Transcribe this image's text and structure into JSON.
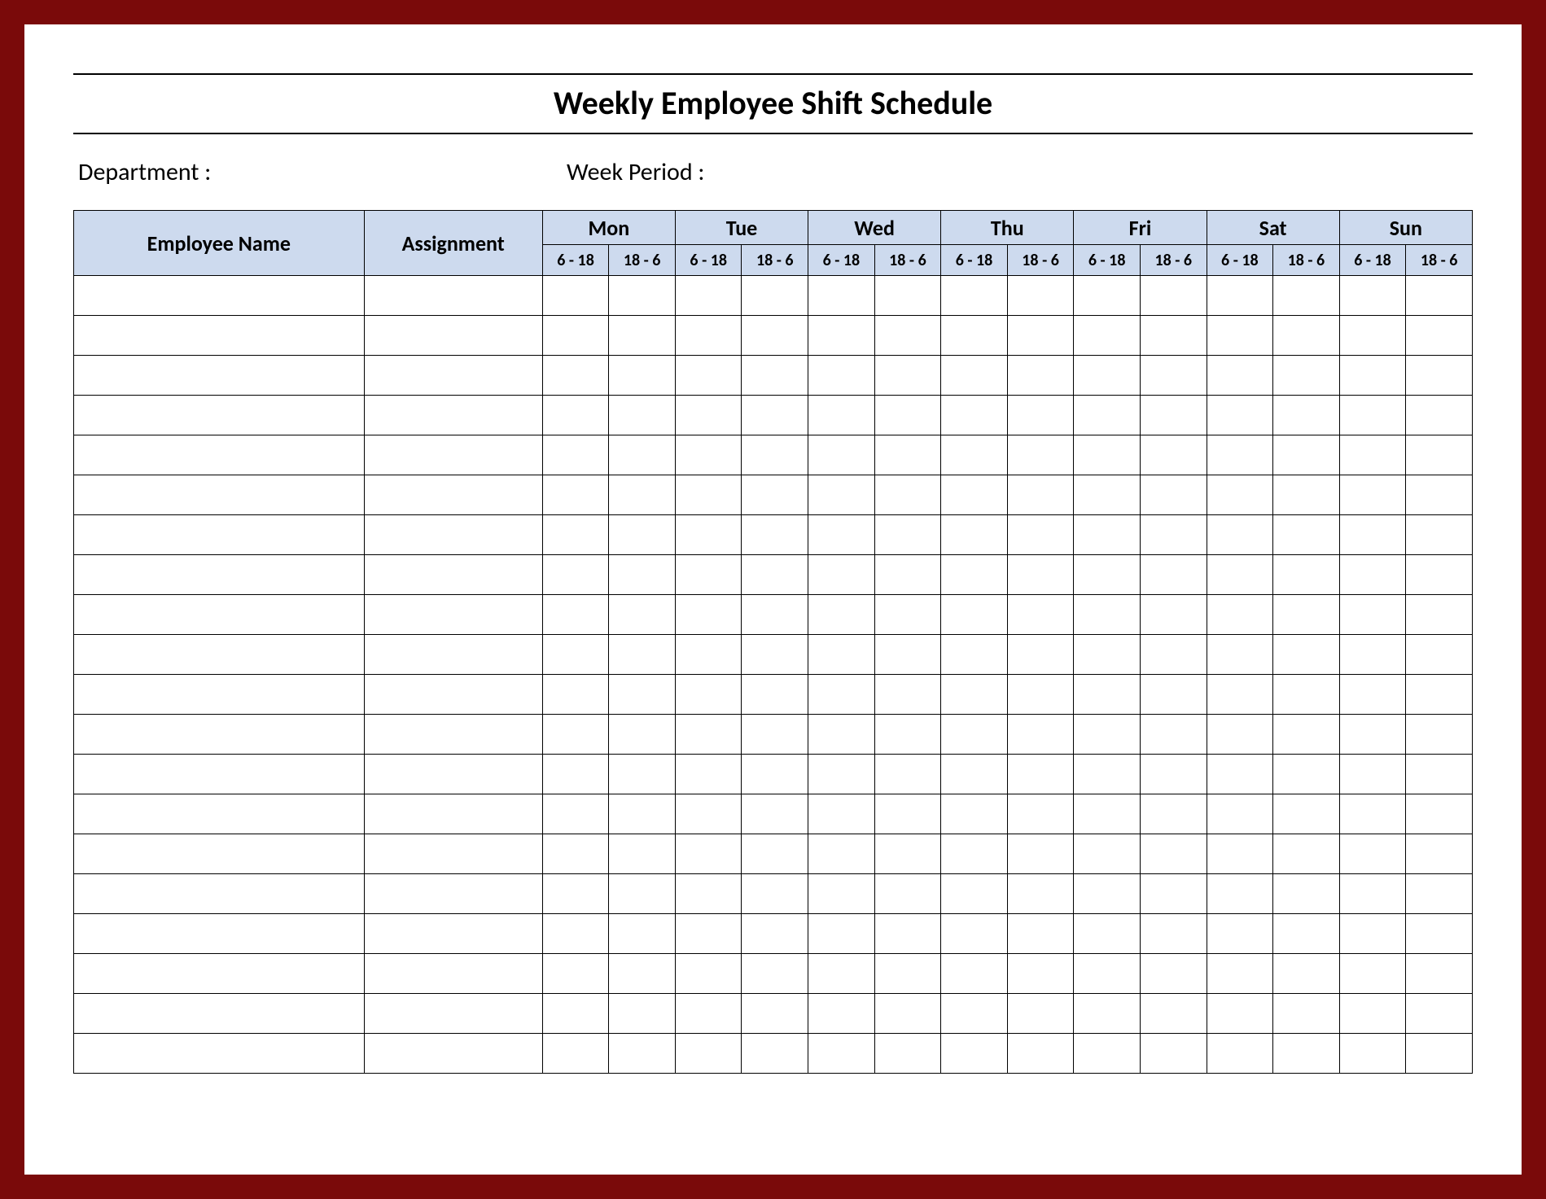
{
  "title": "Weekly Employee Shift Schedule",
  "labels": {
    "department": "Department :",
    "week_period": "Week  Period :",
    "employee_name": "Employee Name",
    "assignment": "Assignment"
  },
  "days": [
    "Mon",
    "Tue",
    "Wed",
    "Thu",
    "Fri",
    "Sat",
    "Sun"
  ],
  "shifts": [
    "6 - 18",
    "18 - 6"
  ],
  "row_count": 20
}
